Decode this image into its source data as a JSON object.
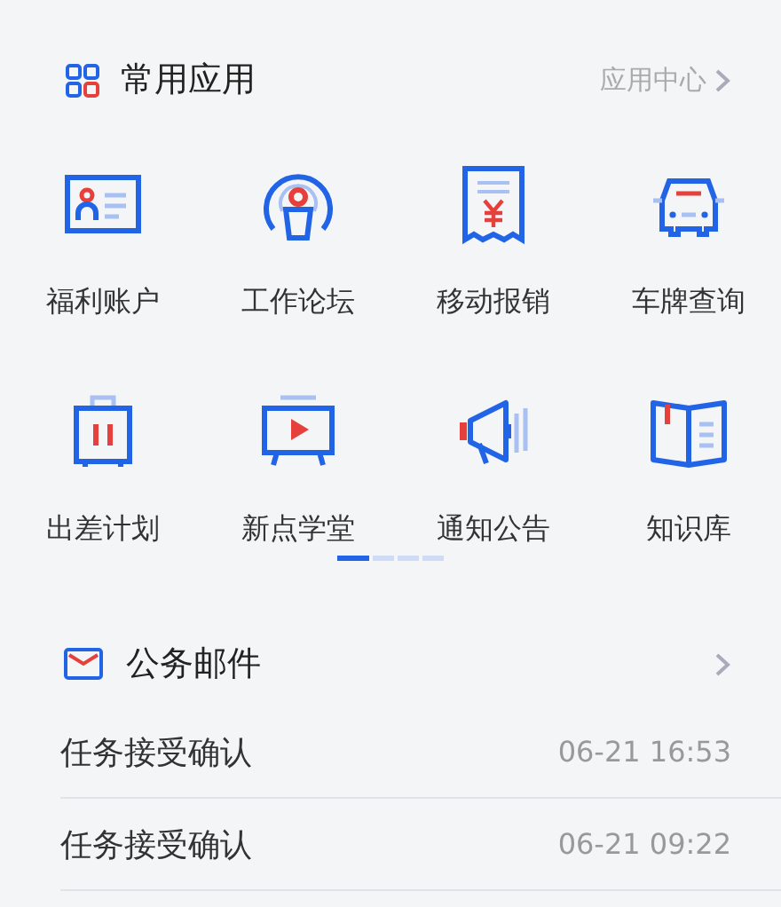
{
  "apps_section": {
    "title": "常用应用",
    "link": "应用中心",
    "apps": [
      {
        "label": "福利账户"
      },
      {
        "label": "工作论坛"
      },
      {
        "label": "移动报销"
      },
      {
        "label": "车牌查询"
      },
      {
        "label": "出差计划"
      },
      {
        "label": "新点学堂"
      },
      {
        "label": "通知公告"
      },
      {
        "label": "知识库"
      }
    ],
    "pages": [
      {
        "selected": true
      },
      {
        "selected": false
      },
      {
        "selected": false
      },
      {
        "selected": false
      }
    ]
  },
  "mail_section": {
    "title": "公务邮件",
    "mails": [
      {
        "subject": "任务接受确认",
        "time": "06-21 16:53"
      },
      {
        "subject": "任务接受确认",
        "time": "06-21 09:22"
      }
    ]
  }
}
